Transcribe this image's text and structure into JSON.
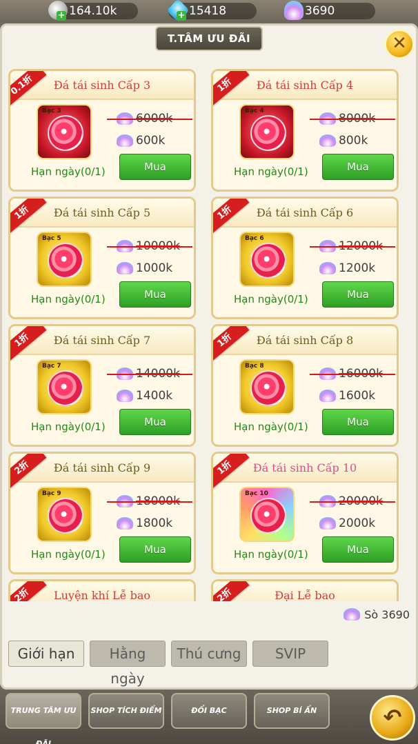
{
  "resources": {
    "silver": "164.10k",
    "gems": "15418",
    "shells": "3690"
  },
  "panel": {
    "title": "T.TÂM ƯU ĐÃI",
    "close_icon": "✕"
  },
  "items": [
    {
      "ribbon": "0.1折",
      "name": "Đá tái sinh Cấp 3",
      "icon_label": "Bạc 3",
      "old_price": "6000k",
      "new_price": "600k",
      "buy": "Mua",
      "limit": "Hạn ngày(0/1)",
      "style": "red"
    },
    {
      "ribbon": "1折",
      "name": "Đá tái sinh Cấp 4",
      "icon_label": "Bạc 4",
      "old_price": "8000k",
      "new_price": "800k",
      "buy": "Mua",
      "limit": "Hạn ngày(0/1)",
      "style": "red"
    },
    {
      "ribbon": "1折",
      "name": "Đá tái sinh Cấp 5",
      "icon_label": "Bạc 5",
      "old_price": "10000k",
      "new_price": "1000k",
      "buy": "Mua",
      "limit": "Hạn ngày(0/1)",
      "style": "gold"
    },
    {
      "ribbon": "1折",
      "name": "Đá tái sinh Cấp 6",
      "icon_label": "Bạc 6",
      "old_price": "12000k",
      "new_price": "1200k",
      "buy": "Mua",
      "limit": "Hạn ngày(0/1)",
      "style": "gold"
    },
    {
      "ribbon": "1折",
      "name": "Đá tái sinh Cấp 7",
      "icon_label": "Bạc 7",
      "old_price": "14000k",
      "new_price": "1400k",
      "buy": "Mua",
      "limit": "Hạn ngày(0/1)",
      "style": "gold"
    },
    {
      "ribbon": "1折",
      "name": "Đá tái sinh Cấp 8",
      "icon_label": "Bạc 8",
      "old_price": "16000k",
      "new_price": "1600k",
      "buy": "Mua",
      "limit": "Hạn ngày(0/1)",
      "style": "gold"
    },
    {
      "ribbon": "2折",
      "name": "Đá tái sinh Cấp 9",
      "icon_label": "Bạc 9",
      "old_price": "18000k",
      "new_price": "1800k",
      "buy": "Mua",
      "limit": "Hạn ngày(0/1)",
      "style": "gold"
    },
    {
      "ribbon": "1折",
      "name": "Đá tái sinh Cấp 10",
      "icon_label": "Bạc 10",
      "old_price": "20000k",
      "new_price": "2000k",
      "buy": "Mua",
      "limit": "Hạn ngày(0/1)",
      "style": "rainbow"
    },
    {
      "ribbon": "2折",
      "name": "Luyện khí Lễ bao"
    },
    {
      "ribbon": "2折",
      "name": "Đại Lễ bao"
    }
  ],
  "shell_total": "Sò 3690",
  "category_tabs": [
    "Giới hạn",
    "Hằng ngày",
    "Thú cưng",
    "SVIP"
  ],
  "bottom_nav": [
    "TRUNG TÂM ƯU ĐÃI",
    "SHOP TÍCH ĐIỂM",
    "ĐỔI BẠC",
    "SHOP BÍ ẨN"
  ],
  "back_icon": "↶"
}
